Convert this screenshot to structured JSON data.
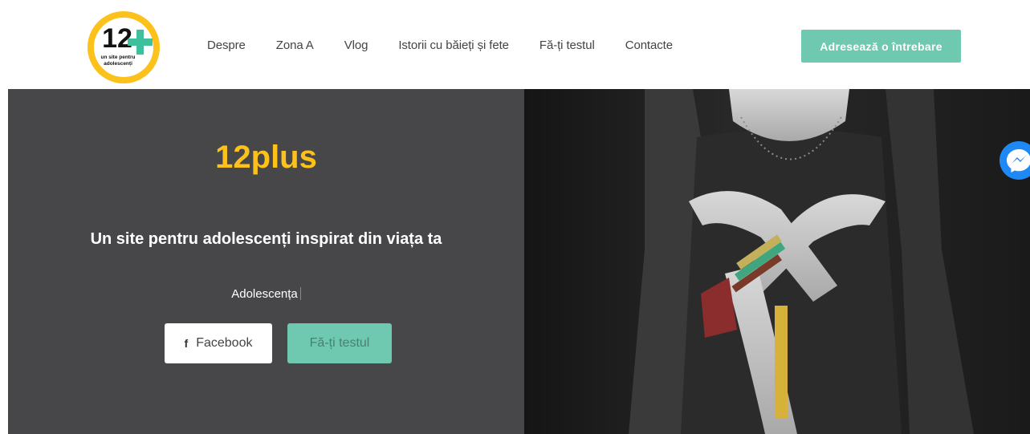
{
  "logo": {
    "number": "12",
    "tagline_1": "un site pentru",
    "tagline_2": "adolescenți",
    "icon": "plus-logo-icon"
  },
  "nav": {
    "items": [
      {
        "label": "Despre"
      },
      {
        "label": "Zona A"
      },
      {
        "label": "Vlog"
      },
      {
        "label": "Istorii cu băieți și fete"
      },
      {
        "label": "Fă-ți testul"
      },
      {
        "label": "Contacte"
      }
    ],
    "cta_label": "Adresează o întrebare"
  },
  "hero": {
    "title": "12plus",
    "subtitle": "Un site pentru adolescenți inspirat din viața ta",
    "typed_text": "Adolescența",
    "facebook_label": "Facebook",
    "facebook_icon": "facebook-icon",
    "test_label": "Fă-ți testul"
  },
  "colors": {
    "accent": "#6fc9b0",
    "title_yellow": "#fcc11b",
    "hero_bg": "#474749",
    "logo_yellow": "#fcc11b",
    "logo_green": "#3fbf9c",
    "messenger_blue": "#1e88f5"
  },
  "widgets": {
    "messenger_icon": "messenger-icon"
  }
}
